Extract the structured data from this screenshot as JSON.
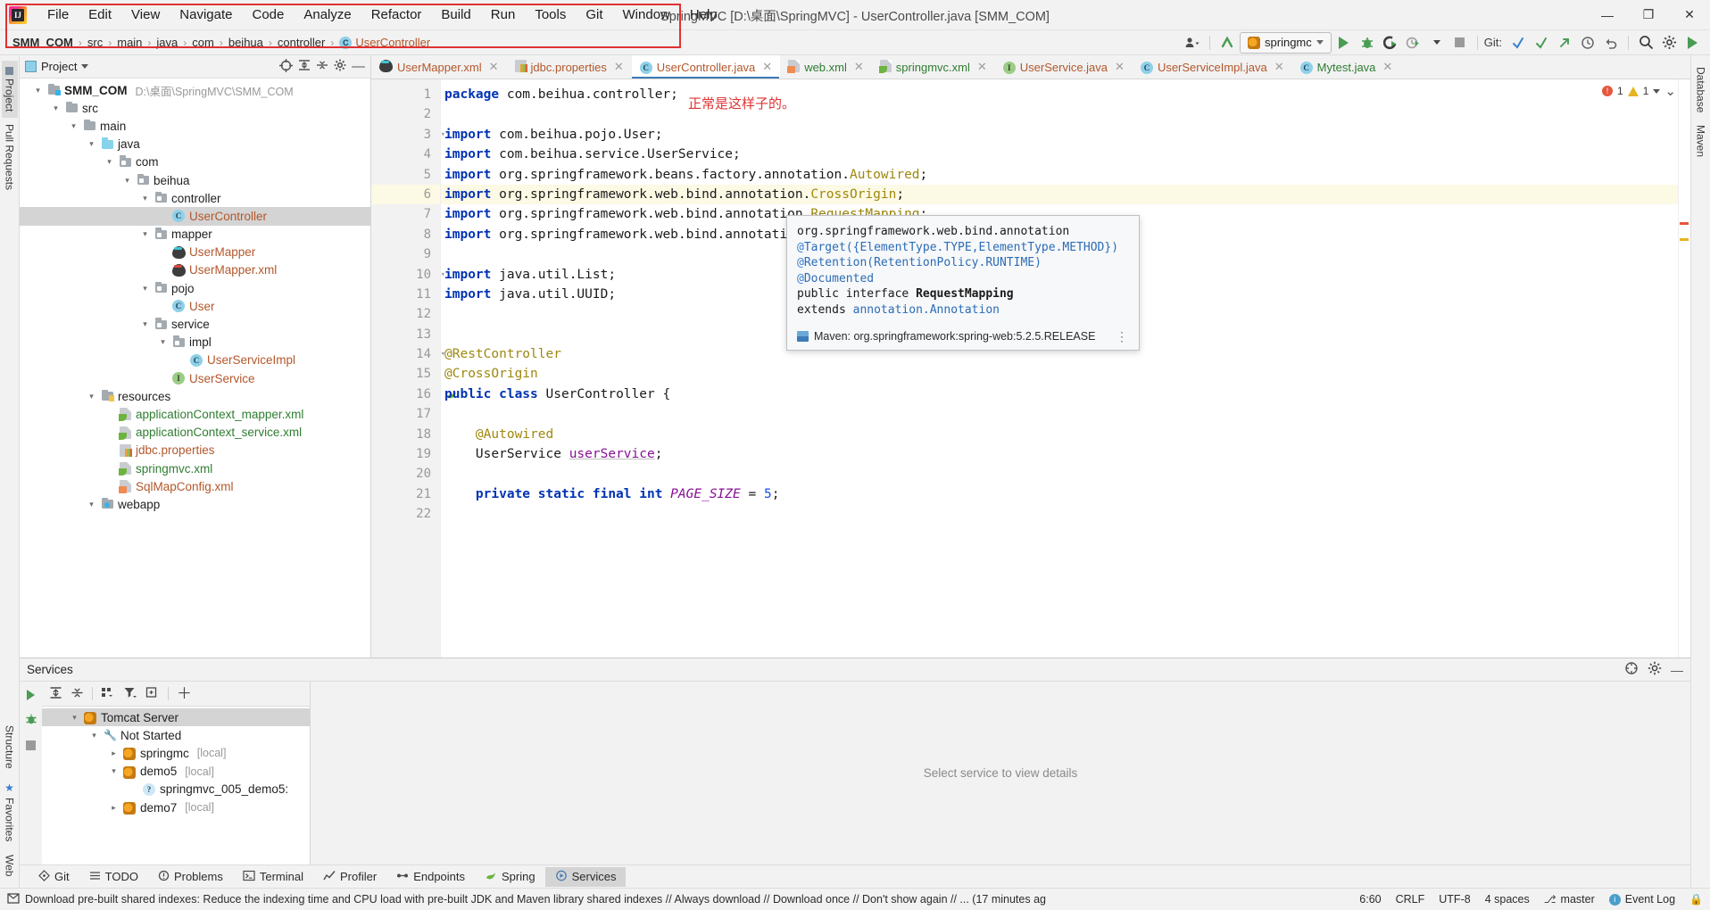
{
  "window": {
    "title": "SpringMVC [D:\\桌面\\SpringMVC] - UserController.java [SMM_COM]",
    "minimize": "—",
    "maximize": "❐",
    "close": "✕",
    "logo_letters": "IJ"
  },
  "menubar": {
    "items": [
      {
        "label": "File",
        "mnemonic": "F"
      },
      {
        "label": "Edit",
        "mnemonic": "E"
      },
      {
        "label": "View",
        "mnemonic": "V"
      },
      {
        "label": "Navigate",
        "mnemonic": "N"
      },
      {
        "label": "Code",
        "mnemonic": "C"
      },
      {
        "label": "Analyze",
        "mnemonic": "z"
      },
      {
        "label": "Refactor",
        "mnemonic": "R"
      },
      {
        "label": "Build",
        "mnemonic": "B"
      },
      {
        "label": "Run",
        "mnemonic": "u"
      },
      {
        "label": "Tools",
        "mnemonic": "T"
      },
      {
        "label": "Git",
        "mnemonic": "G"
      },
      {
        "label": "Window",
        "mnemonic": "W"
      },
      {
        "label": "Help",
        "mnemonic": "H"
      }
    ]
  },
  "breadcrumb": {
    "items": [
      "SMM_COM",
      "src",
      "main",
      "java",
      "com",
      "beihua",
      "controller",
      "UserController"
    ],
    "separator": "›",
    "class_badge": "C"
  },
  "toolbar": {
    "run_config": "springmc",
    "git_label": "Git:",
    "icons": {
      "user": "user-settings-icon",
      "update": "update-project-icon",
      "run": "run-icon",
      "debug": "debug-icon",
      "run_coverage": "run-with-coverage-icon",
      "profile": "profiler-icon",
      "stop": "stop-icon",
      "commit": "commit-icon",
      "push": "push-icon",
      "history": "history-icon",
      "rollback": "rollback-icon",
      "search": "search-everywhere-icon",
      "settings": "settings-icon",
      "fold": "expand-icon"
    }
  },
  "project_panel": {
    "header": "Project",
    "tree": [
      {
        "depth": 0,
        "twist": "v",
        "icon": "folder-src",
        "label": "SMM_COM",
        "bold": true,
        "sub": "D:\\桌面\\SpringMVC\\SMM_COM",
        "color": "dark"
      },
      {
        "depth": 1,
        "twist": "v",
        "icon": "folder",
        "label": "src",
        "color": "dark"
      },
      {
        "depth": 2,
        "twist": "v",
        "icon": "folder",
        "label": "main",
        "color": "dark"
      },
      {
        "depth": 3,
        "twist": "v",
        "icon": "folder-java",
        "label": "java",
        "color": "dark"
      },
      {
        "depth": 4,
        "twist": "v",
        "icon": "folder-pkg",
        "label": "com",
        "color": "dark"
      },
      {
        "depth": 5,
        "twist": "v",
        "icon": "folder-pkg",
        "label": "beihua",
        "color": "dark"
      },
      {
        "depth": 6,
        "twist": "v",
        "icon": "folder-pkg",
        "label": "controller",
        "color": "dark"
      },
      {
        "depth": 7,
        "twist": "",
        "icon": "class",
        "label": "UserController",
        "color": "orange",
        "selected": true
      },
      {
        "depth": 6,
        "twist": "v",
        "icon": "folder-pkg",
        "label": "mapper",
        "color": "dark"
      },
      {
        "depth": 7,
        "twist": "",
        "icon": "mybatis",
        "label": "UserMapper",
        "color": "orange"
      },
      {
        "depth": 7,
        "twist": "",
        "icon": "mybatis-red",
        "label": "UserMapper.xml",
        "color": "orange"
      },
      {
        "depth": 6,
        "twist": "v",
        "icon": "folder-pkg",
        "label": "pojo",
        "color": "dark"
      },
      {
        "depth": 7,
        "twist": "",
        "icon": "class",
        "label": "User",
        "color": "orange"
      },
      {
        "depth": 6,
        "twist": "v",
        "icon": "folder-pkg",
        "label": "service",
        "color": "dark"
      },
      {
        "depth": 7,
        "twist": "v",
        "icon": "folder-pkg",
        "label": "impl",
        "color": "dark"
      },
      {
        "depth": 8,
        "twist": "",
        "icon": "class",
        "label": "UserServiceImpl",
        "color": "orange"
      },
      {
        "depth": 7,
        "twist": "",
        "icon": "interface",
        "label": "UserService",
        "color": "orange"
      },
      {
        "depth": 3,
        "twist": "v",
        "icon": "folder-res",
        "label": "resources",
        "color": "dark"
      },
      {
        "depth": 4,
        "twist": "",
        "icon": "xml-spring",
        "label": "applicationContext_mapper.xml",
        "color": "green"
      },
      {
        "depth": 4,
        "twist": "",
        "icon": "xml-spring",
        "label": "applicationContext_service.xml",
        "color": "green"
      },
      {
        "depth": 4,
        "twist": "",
        "icon": "props",
        "label": "jdbc.properties",
        "color": "orange"
      },
      {
        "depth": 4,
        "twist": "",
        "icon": "xml-spring",
        "label": "springmvc.xml",
        "color": "green"
      },
      {
        "depth": 4,
        "twist": "",
        "icon": "xml",
        "label": "SqlMapConfig.xml",
        "color": "orange"
      },
      {
        "depth": 3,
        "twist": "v",
        "icon": "folder-web",
        "label": "webapp",
        "color": "dark"
      }
    ]
  },
  "editor": {
    "tabs": [
      {
        "label": "UserMapper.xml",
        "icon": "mybatis-icon",
        "color": "orange",
        "active": false
      },
      {
        "label": "jdbc.properties",
        "icon": "properties-icon",
        "color": "orange",
        "active": false
      },
      {
        "label": "UserController.java",
        "icon": "class-icon",
        "color": "orange",
        "active": true
      },
      {
        "label": "web.xml",
        "icon": "xml-icon",
        "color": "green",
        "active": false
      },
      {
        "label": "springmvc.xml",
        "icon": "spring-xml-icon",
        "color": "green",
        "active": false
      },
      {
        "label": "UserService.java",
        "icon": "interface-icon",
        "color": "orange",
        "active": false
      },
      {
        "label": "UserServiceImpl.java",
        "icon": "class-icon",
        "color": "orange",
        "active": false
      },
      {
        "label": "Mytest.java",
        "icon": "class-icon",
        "color": "green",
        "active": false
      }
    ],
    "close_glyph": "✕",
    "annotation_note": "正常是这样子的。",
    "error_count": "1",
    "warning_count": "1",
    "lines": [
      {
        "n": 1,
        "html": "<span class=\"kw\">package</span> com.beihua.controller;"
      },
      {
        "n": 2,
        "html": ""
      },
      {
        "n": 3,
        "html": "<span class=\"kw\">import</span> com.beihua.pojo.User;",
        "fold": true
      },
      {
        "n": 4,
        "html": "<span class=\"kw\">import</span> com.beihua.service.UserService;"
      },
      {
        "n": 5,
        "html": "<span class=\"kw\">import</span> org.springframework.beans.factory.annotation.<span class=\"ann\">Autowired</span>;"
      },
      {
        "n": 6,
        "html": "<span class=\"kw\">import</span> org.springframework.web.bind.annotation.<span class=\"ann\">CrossOrigin</span>;",
        "current": true
      },
      {
        "n": 7,
        "html": "<span class=\"kw\">import</span> org.springframework.web.bind.annotation.<span class=\"ann\">RequestMapping</span>;"
      },
      {
        "n": 8,
        "html": "<span class=\"kw\">import</span> org.springframework.web.bind.annotation."
      },
      {
        "n": 9,
        "html": ""
      },
      {
        "n": 10,
        "html": "<span class=\"kw\">import</span> java.util.List;",
        "fold": true
      },
      {
        "n": 11,
        "html": "<span class=\"kw\">import</span> java.util.UUID;"
      },
      {
        "n": 12,
        "html": ""
      },
      {
        "n": 13,
        "html": ""
      },
      {
        "n": 14,
        "html": "<span class=\"ann\">@RestController</span>",
        "fold": true
      },
      {
        "n": 15,
        "html": "<span class=\"ann\">@CrossOrigin</span>"
      },
      {
        "n": 16,
        "html": "<span class=\"kw\">public class</span> UserController {",
        "gicon": "spring-bean"
      },
      {
        "n": 17,
        "html": ""
      },
      {
        "n": 18,
        "html": "    <span class=\"ann\">@Autowired</span>"
      },
      {
        "n": 19,
        "html": "    UserService <span class=\"fld underl\">userService</span>;"
      },
      {
        "n": 20,
        "html": ""
      },
      {
        "n": 21,
        "html": "    <span class=\"kw\">private static final int</span> <span class=\"stat\">PAGE_SIZE</span> = <span class=\"num\">5</span>;"
      },
      {
        "n": 22,
        "html": ""
      }
    ]
  },
  "doc_popup": {
    "line1": "org.springframework.web.bind.annotation",
    "line2_pre": "@",
    "line2": "Target({ElementType.TYPE,ElementType.METHOD})",
    "line3": "Retention(RetentionPolicy.RUNTIME)",
    "line4": "Documented",
    "line5_pre": "public interface ",
    "line5_bold": "RequestMapping",
    "line6_pre": "extends ",
    "line6": "annotation.Annotation",
    "footer": "Maven: org.springframework:spring-web:5.2.5.RELEASE",
    "more": "⋮"
  },
  "services": {
    "title": "Services",
    "placeholder": "Select service to view details",
    "tree": [
      {
        "depth": 0,
        "twist": "v",
        "icon": "tomcat",
        "label": "Tomcat Server",
        "selected": true
      },
      {
        "depth": 1,
        "twist": "v",
        "icon": "wrench",
        "label": "Not Started"
      },
      {
        "depth": 2,
        "twist": ">",
        "icon": "tomcat",
        "label": "springmc",
        "sub": "[local]"
      },
      {
        "depth": 2,
        "twist": "v",
        "icon": "tomcat",
        "label": "demo5",
        "sub": "[local]"
      },
      {
        "depth": 3,
        "twist": "",
        "icon": "deploy",
        "label": "springmvc_005_demo5:"
      },
      {
        "depth": 2,
        "twist": ">",
        "icon": "tomcat",
        "label": "demo7",
        "sub": "[local]"
      }
    ]
  },
  "left_strip": {
    "tabs": [
      "Project",
      "Pull Requests"
    ],
    "bottom": [
      "Structure",
      "Favorites",
      "Web"
    ]
  },
  "right_strip": {
    "tabs": [
      "Database",
      "Maven"
    ]
  },
  "bottom_bar": {
    "items": [
      {
        "label": "Git",
        "icon": "git-icon",
        "active": false
      },
      {
        "label": "TODO",
        "icon": "todo-icon",
        "active": false
      },
      {
        "label": "Problems",
        "icon": "problems-icon",
        "active": false
      },
      {
        "label": "Terminal",
        "icon": "terminal-icon",
        "active": false
      },
      {
        "label": "Profiler",
        "icon": "profiler-icon",
        "active": false
      },
      {
        "label": "Endpoints",
        "icon": "endpoints-icon",
        "active": false
      },
      {
        "label": "Spring",
        "icon": "spring-icon",
        "active": false
      },
      {
        "label": "Services",
        "icon": "services-icon",
        "active": true
      }
    ]
  },
  "statusbar": {
    "message": "Download pre-built shared indexes: Reduce the indexing time and CPU load with pre-built JDK and Maven library shared indexes // Always download // Download once // Don't show again // ... (17 minutes ag",
    "caret": "6:60",
    "line_sep": "CRLF",
    "encoding": "UTF-8",
    "indent": "4 spaces",
    "branch": "master",
    "event_log": "Event Log",
    "event_badge": "i"
  }
}
